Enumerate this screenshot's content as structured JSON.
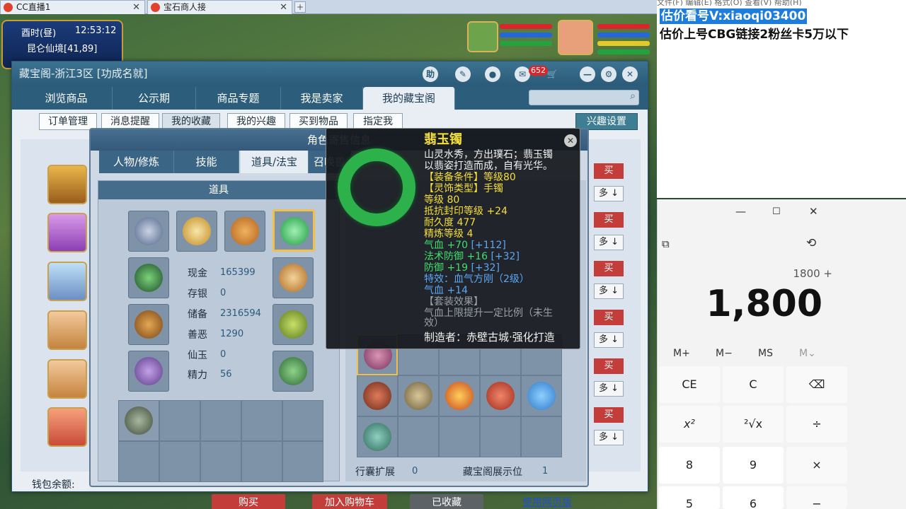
{
  "browser": {
    "tabs": [
      {
        "label": "CC直播1"
      },
      {
        "label": "宝石商人接"
      }
    ],
    "add_tab": "+"
  },
  "hud": {
    "time_label": "酉时(昼)",
    "clock": "12:53:12",
    "location": "昆仑仙境[41,89]"
  },
  "window": {
    "title": "藏宝阁-浙江3区 [功成名就]",
    "help_label": "助",
    "notification_count": "652",
    "nav_tabs": [
      {
        "label": "浏览商品"
      },
      {
        "label": "公示期"
      },
      {
        "label": "商品专题"
      },
      {
        "label": "我是卖家"
      },
      {
        "label": "我的藏宝阁"
      }
    ],
    "sub_buttons": [
      {
        "label": "订单管理"
      },
      {
        "label": "消息提醒"
      },
      {
        "label": "我的收藏"
      },
      {
        "label": "我的兴趣"
      },
      {
        "label": "买到物品"
      },
      {
        "label": "指定我"
      }
    ],
    "interest_button": "兴趣设置",
    "buy_short": "买",
    "more_short": "多 ↓",
    "wallet_label": "钱包余额:",
    "bottom_buttons": {
      "buy": "购买",
      "add_cart": "加入购物车",
      "collected": "已收藏",
      "web_version": "使用网页版"
    }
  },
  "dialog": {
    "title": "角色寄售信息",
    "tabs": [
      {
        "label": "人物/修炼"
      },
      {
        "label": "技能"
      },
      {
        "label": "道具/法宝"
      },
      {
        "label": "召唤兽"
      }
    ],
    "items_panel_title": "道具",
    "stats": [
      {
        "label": "现金",
        "value": "165399"
      },
      {
        "label": "存银",
        "value": "0"
      },
      {
        "label": "储备",
        "value": "2316594"
      },
      {
        "label": "善恶",
        "value": "1290"
      },
      {
        "label": "仙玉",
        "value": "0"
      },
      {
        "label": "精力",
        "value": "56"
      }
    ],
    "bag_expand_label": "行囊扩展",
    "bag_expand_value": "0",
    "display_label": "藏宝阁展示位",
    "display_value": "1"
  },
  "tooltip": {
    "name": "翡玉镯",
    "desc_line1": "山灵水秀，方出璞石；翡玉镯",
    "desc_line2": "以翡姿打造而成，自有光华。",
    "req": "【装备条件】等级80",
    "type": "【灵饰类型】手镯",
    "level": "等级 80",
    "attr1": "抵抗封印等级 +24",
    "durability": "耐久度 477",
    "refine": "精炼等级 4",
    "hp": "气血 +70",
    "hp_bonus": "[+112]",
    "mdef": "法术防御 +16",
    "mdef_bonus": "[+32]",
    "def": "防御 +19",
    "def_bonus": "[+32]",
    "special": "特效：血气方刚（2级）",
    "extra_hp": "气血 +14",
    "set_title": "【套装效果】",
    "set_desc": "气血上限提升一定比例（未生",
    "set_desc2": "效）",
    "maker": "制造者：赤壁古城·强化打造"
  },
  "overlay": {
    "line1": "估价看号V:xiaoqi03400",
    "line2": "估价上号CBG链接2",
    "line2b": "粉丝卡5万以下",
    "menu": "文件(F)   编辑(E)   格式(O)   查看(V)   帮助(H)"
  },
  "calculator": {
    "expression": "1800 +",
    "display": "1,800",
    "memory": [
      "M+",
      "M−",
      "MS",
      "M⌄"
    ],
    "keys_row1": [
      "CE",
      "C",
      "⌫"
    ],
    "keys_row2": [
      "x²",
      "²√x",
      "÷"
    ],
    "keys_row3": [
      "8",
      "9",
      "×"
    ],
    "keys_row4": [
      "5",
      "6",
      "−"
    ]
  },
  "colors": {
    "nav_bg": "#2c5d7a",
    "buy_red": "#c33d3a",
    "tooltip_yellow": "#f5df3a",
    "tooltip_green": "#3ee06b",
    "highlight_blue": "#1c7ddb"
  }
}
